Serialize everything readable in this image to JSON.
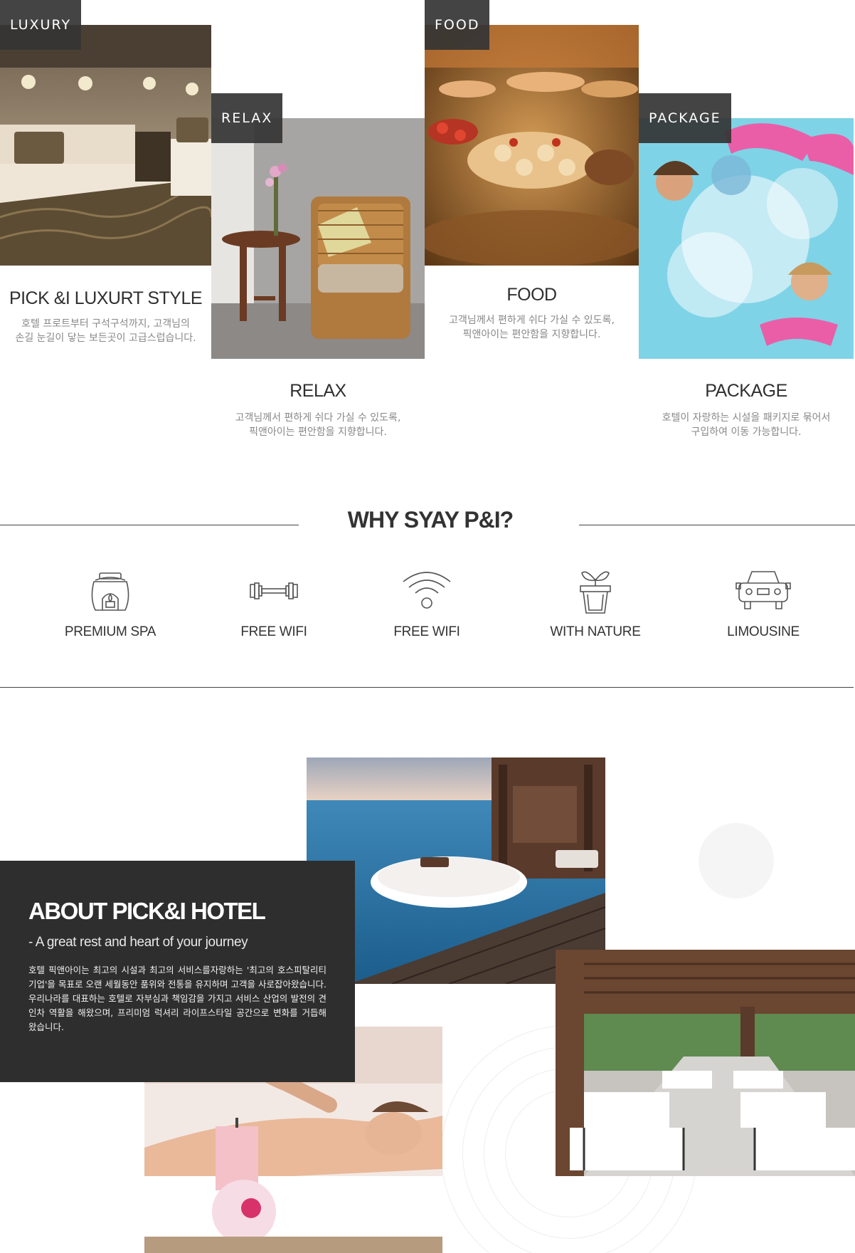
{
  "features": [
    {
      "tag": "LUXURY",
      "title": "PICK &I LUXURT STYLE",
      "desc_lines": [
        "호텔 프로트부터 구석구석까지, 고객님의",
        "손길 눈길이 닿는 보든곳이 고급스럽습니다."
      ],
      "photo_icon": "hotel-bedroom-photo"
    },
    {
      "tag": "RELAX",
      "title": "RELAX",
      "desc_lines": [
        "고객님께서 편하게 쉬다 가실 수 있도록,",
        "픽앤아이는 편안함을 지향합니다."
      ],
      "photo_icon": "wicker-armchair-photo"
    },
    {
      "tag": "FOOD",
      "title": "FOOD",
      "desc_lines": [
        "고객님께서 편하게 쉬다 가실 수 있도록,",
        "픽앤아이는 편안함을 지향합니다."
      ],
      "photo_icon": "buffet-food-photo"
    },
    {
      "tag": "PACKAGE",
      "title": "PACKAGE",
      "desc_lines": [
        "호텔이 자랑하는 시설을 패키지로 묶어서",
        "구입하여 이동 가능합니다."
      ],
      "photo_icon": "pool-splash-photo"
    }
  ],
  "why": {
    "title": "WHY SYAY P&I?",
    "items": [
      {
        "label": "PREMIUM SPA",
        "icon": "spa-burner-icon"
      },
      {
        "label": "FREE WIFI",
        "icon": "dumbbell-icon"
      },
      {
        "label": "FREE WIFI",
        "icon": "wifi-icon"
      },
      {
        "label": "WITH NATURE",
        "icon": "potted-plant-icon"
      },
      {
        "label": "LIMOUSINE",
        "icon": "car-icon"
      }
    ]
  },
  "about": {
    "title": "ABOUT PICK&I HOTEL",
    "subtitle": "- A great rest and heart of your journey",
    "body": "호텔 픽앤아이는 최고의 시설과 최고의 서비스를자랑하는 '최고의 호스피탈리티 기업'을 목표로 오랜 세월동안 품위와 전통을 유지하며 고객을 사로잡아왔습니다. 우리나라를 대표하는 호텔로 자부심과 책임감을 가지고 서비스 산업의 발전의 견인차 역활을 해왔으며, 프리미엄 럭셔리 라이프스타일 공간으로 변화를 거듭해 왔습니다.",
    "photos": [
      "ocean-deck-photo",
      "spa-massage-photo",
      "terrace-restaurant-photo"
    ]
  },
  "colors": {
    "tag_bg": "#343434",
    "about_bg": "#2e2e2e",
    "text_dark": "#2f2f2f",
    "text_muted": "#888888"
  }
}
